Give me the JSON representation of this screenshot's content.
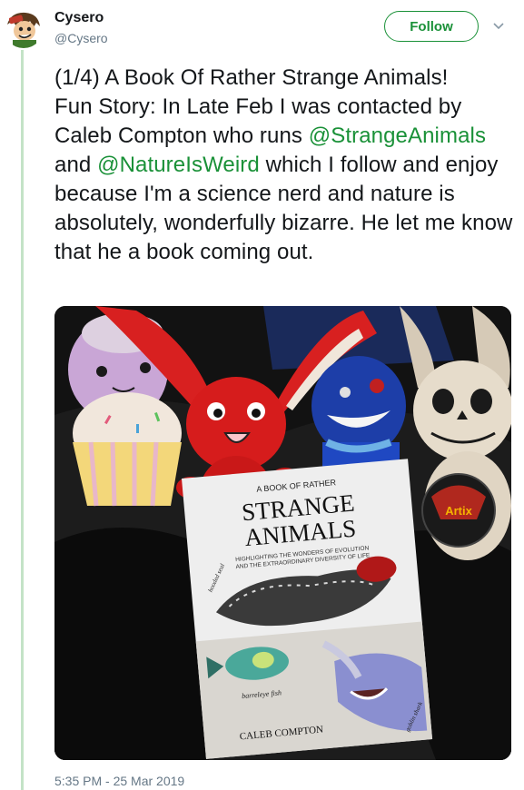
{
  "author": {
    "display_name": "Cysero",
    "handle": "@Cysero",
    "avatar_icon": "cartoon-avatar-icon"
  },
  "follow_button": {
    "label": "Follow"
  },
  "menu": {
    "icon": "chevron-down-icon"
  },
  "tweet": {
    "line1": "(1/4) A Book Of Rather Strange Animals!",
    "line2_pre": "Fun Story: In Late Feb I was contacted by Caleb Compton who runs ",
    "mention1": "@StrangeAnimals",
    "mid": " and ",
    "mention2": "@NatureIsWeird",
    "line2_post": " which I follow and enjoy because I'm a science nerd and nature is absolutely, wonderfully bizarre. He let me know that he a book coming out."
  },
  "photo": {
    "book_top": "A BOOK OF RATHER",
    "book_title_1": "STRANGE",
    "book_title_2": "ANIMALS",
    "book_subtitle_1": "HIGHLIGHTING THE WONDERS OF EVOLUTION",
    "book_subtitle_2": "AND THE EXTRAORDINARY DIVERSITY OF LIFE",
    "book_author": "CALEB COMPTON",
    "caption_seal": "hooded seal",
    "caption_fish": "barreleye fish",
    "caption_shark": "goblin shark",
    "button_text": "Artix"
  },
  "timestamp": "5:35 PM - 25 Mar 2019",
  "colors": {
    "accent": "#1a9138",
    "thread_line": "#c4e3c7",
    "secondary_text": "#657786"
  }
}
